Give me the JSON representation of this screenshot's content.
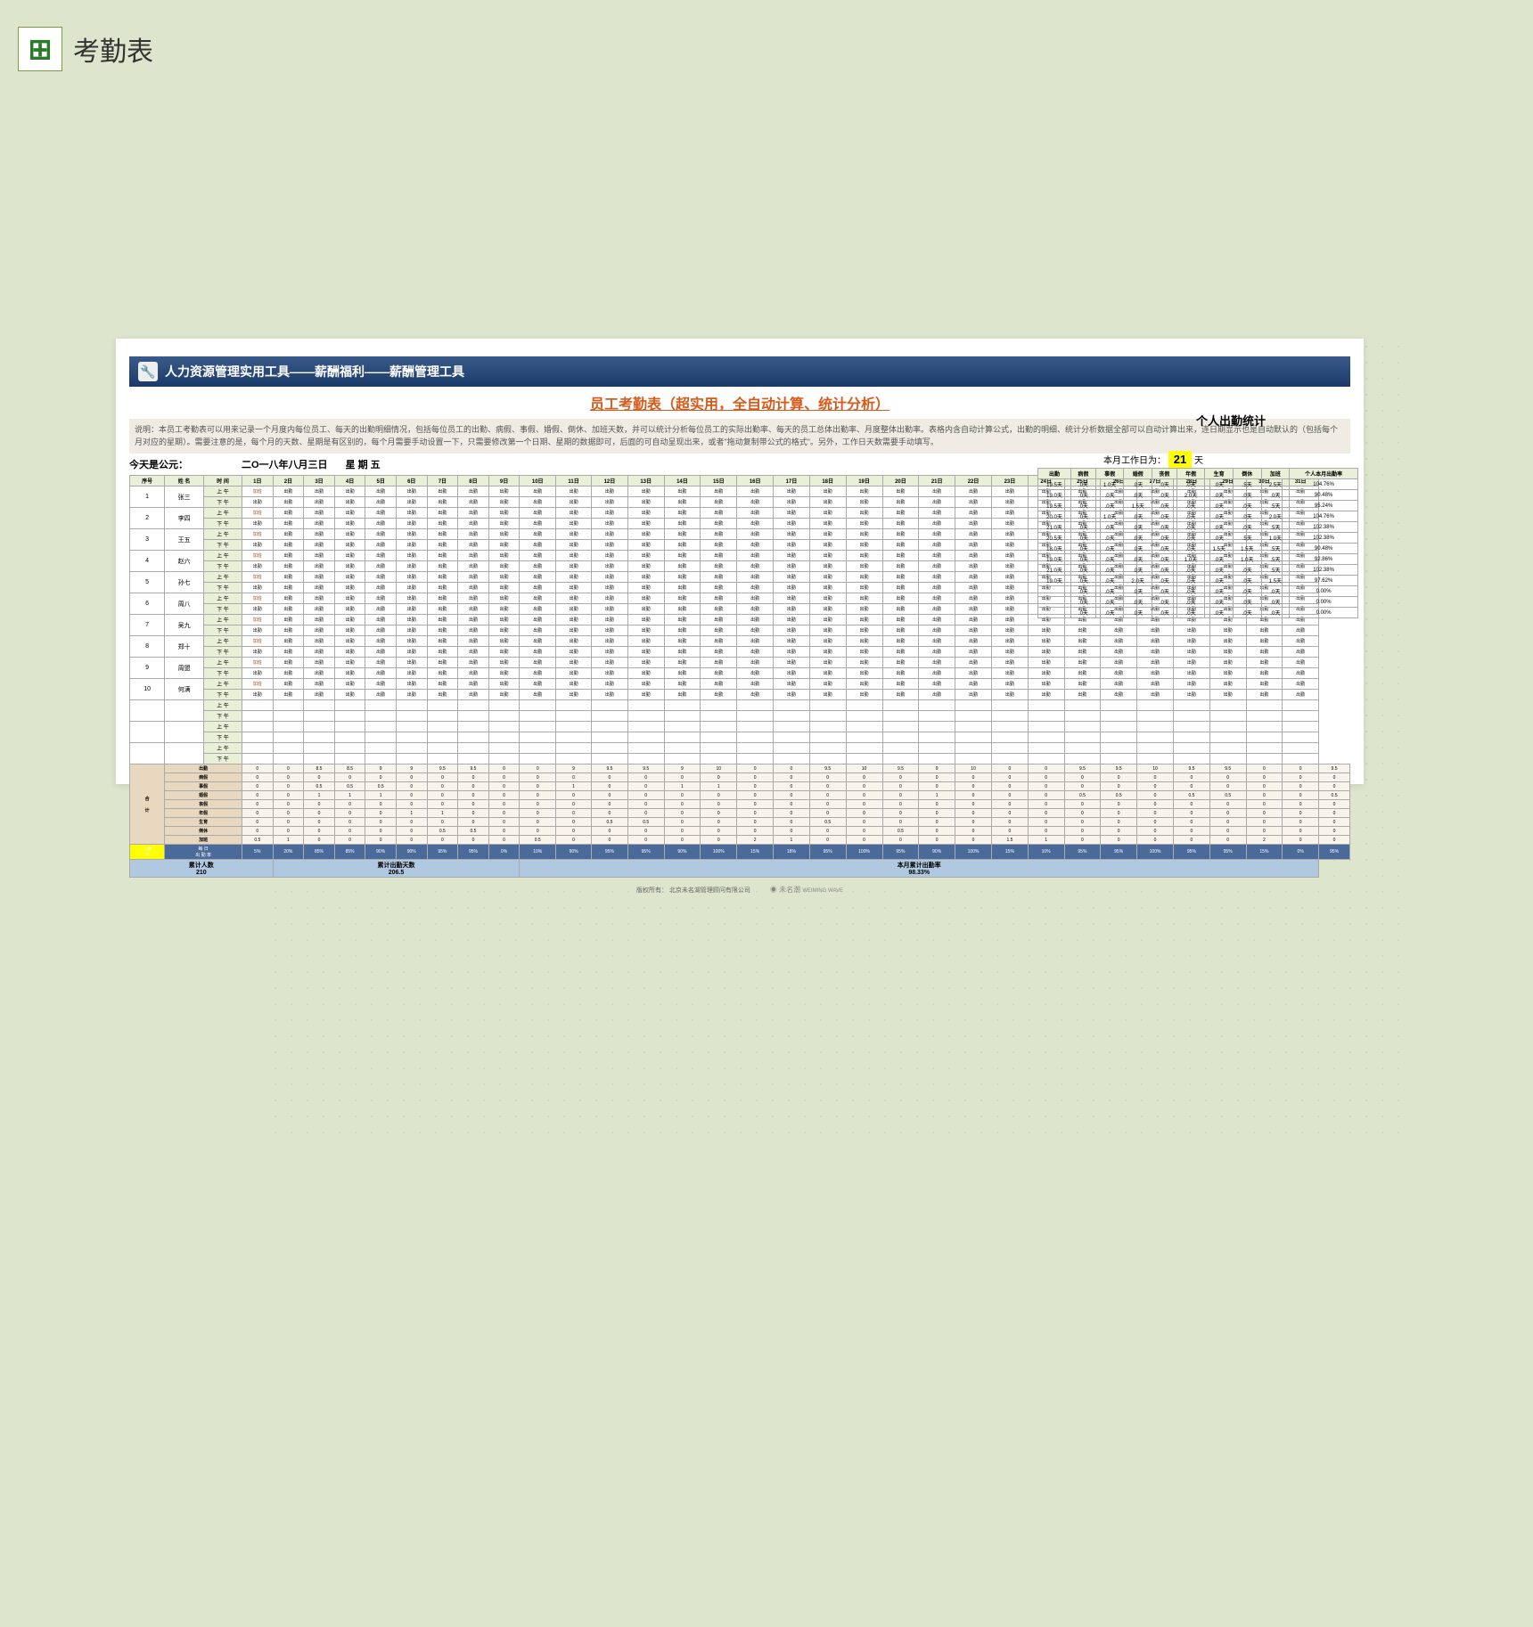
{
  "header": {
    "title": "考勤表"
  },
  "banner": "人力资源管理实用工具——薪酬福利——薪酬管理工具",
  "sub_title": "员工考勤表（超实用，全自动计算、统计分析）",
  "description": "说明：本员工考勤表可以用来记录一个月度内每位员工、每天的出勤明细情况，包括每位员工的出勤、病假、事假、婚假、倒休、加班天数，并可以统计分析每位员工的实际出勤率、每天的员工总体出勤率、月度整体出勤率。表格内含自动计算公式，出勤的明细、统计分析数据全部可以自动计算出来，连日期显示也是自动默认的（包括每个月对应的星期）。需要注意的是，每个月的天数、星期是有区别的，每个月需要手动设置一下，只需要修改第一个日期、星期的数据即可，后面的可自动呈现出来，或者\"拖动复制带公式的格式\"。另外，工作日天数需要手动填写。",
  "stats_title": "个人出勤统计",
  "today_label": "今天是公元：",
  "today_date": "二O一八年八月三日",
  "today_dow": "星 期  五",
  "workday_label": "本月工作日为：",
  "workday_value": "21",
  "workday_unit": "天",
  "main_headers": [
    "序号",
    "姓  名",
    "时 间"
  ],
  "days": [
    "1日",
    "2日",
    "3日",
    "4日",
    "5日",
    "6日",
    "7日",
    "8日",
    "9日",
    "10日",
    "11日",
    "12日",
    "13日",
    "14日",
    "15日",
    "16日",
    "17日",
    "18日",
    "19日",
    "20日",
    "21日",
    "22日",
    "23日",
    "24日",
    "25日",
    "26日",
    "27日",
    "28日",
    "29日",
    "30日",
    "31日"
  ],
  "employees": [
    {
      "no": "1",
      "name": "张三"
    },
    {
      "no": "2",
      "name": "李四"
    },
    {
      "no": "3",
      "name": "王五"
    },
    {
      "no": "4",
      "name": "赵六"
    },
    {
      "no": "5",
      "name": "孙七"
    },
    {
      "no": "6",
      "name": "周八"
    },
    {
      "no": "7",
      "name": "吴九"
    },
    {
      "no": "8",
      "name": "郑十"
    },
    {
      "no": "9",
      "name": "周盟"
    },
    {
      "no": "10",
      "name": "何满"
    }
  ],
  "time_labels": {
    "am": "上 午",
    "pm": "下 午"
  },
  "cell_values": {
    "attend": "出勤",
    "ot": "加班",
    "rest": "倒休",
    "sick": "病假",
    "marriage": "婚假",
    "personal": "事假",
    "year": "年假",
    "birth": "生育"
  },
  "stats_headers": [
    "出勤",
    "病假",
    "事假",
    "婚假",
    "丧假",
    "年假",
    "生育",
    "倒休",
    "加班",
    "个人本月出勤率"
  ],
  "stats_rows": [
    [
      "19.5天",
      ".0天",
      "1.0天",
      ".0天",
      ".0天",
      ".0天",
      ".0天",
      ".5天",
      "2.5天",
      "104.76%"
    ],
    [
      "19.0天",
      ".0天",
      ".0天",
      ".0天",
      ".0天",
      "2.0天",
      ".0天",
      ".0天",
      ".0天",
      "90.48%"
    ],
    [
      "19.5天",
      ".0天",
      ".0天",
      "1.5天",
      ".0天",
      ".0天",
      ".0天",
      ".0天",
      ".5天",
      "95.24%"
    ],
    [
      "20.0天",
      ".0天",
      "1.0天",
      ".0天",
      ".0天",
      ".0天",
      ".0天",
      ".0天",
      "2.0天",
      "104.76%"
    ],
    [
      "21.0天",
      ".0天",
      ".0天",
      ".0天",
      ".0天",
      ".0天",
      ".0天",
      ".0天",
      ".5天",
      "102.38%"
    ],
    [
      "20.5天",
      ".0天",
      ".0天",
      ".0天",
      ".0天",
      ".0天",
      ".0天",
      ".5天",
      "1.0天",
      "102.38%"
    ],
    [
      "18.0天",
      ".0天",
      ".0天",
      ".0天",
      ".0天",
      ".0天",
      "1.5天",
      "1.5天",
      ".5天",
      "90.48%"
    ],
    [
      "19.0天",
      ".0天",
      ".0天",
      ".0天",
      ".0天",
      "1.0天",
      ".0天",
      "1.0天",
      ".5天",
      "92.86%"
    ],
    [
      "21.0天",
      ".0天",
      ".0天",
      ".0天",
      ".0天",
      ".0天",
      ".0天",
      ".0天",
      ".5天",
      "102.38%"
    ],
    [
      "19.0天",
      ".0天",
      ".0天",
      "2.0天",
      ".0天",
      ".0天",
      ".0天",
      ".0天",
      "1.5天",
      "97.62%"
    ],
    [
      "",
      ".0天",
      ".0天",
      ".0天",
      ".0天",
      ".0天",
      ".0天",
      ".0天",
      ".0天",
      "0.00%"
    ],
    [
      "",
      ".0天",
      ".0天",
      ".0天",
      ".0天",
      ".0天",
      ".0天",
      ".0天",
      ".0天",
      "0.00%"
    ],
    [
      "",
      ".0天",
      ".0天",
      ".0天",
      ".0天",
      ".0天",
      ".0天",
      ".0天",
      ".0天",
      "0.00%"
    ]
  ],
  "sum_labels": [
    "出勤",
    "病假",
    "事假",
    "婚假",
    "丧假",
    "年假",
    "生育",
    "倒休",
    "加班"
  ],
  "sum_section_label": "合\n\n计",
  "sum_rows": {
    "出勤": [
      "0",
      "0",
      "8.5",
      "8.5",
      "9",
      "9",
      "9.5",
      "9.5",
      "0",
      "0",
      "9",
      "9.5",
      "9.5",
      "9",
      "10",
      "0",
      "0",
      "9.5",
      "10",
      "9.5",
      "9",
      "10",
      "0",
      "0",
      "9.5",
      "9.5",
      "10",
      "9.5",
      "9.5",
      "0",
      "0",
      "9.5"
    ],
    "病假": [
      "0",
      "0",
      "0",
      "0",
      "0",
      "0",
      "0",
      "0",
      "0",
      "0",
      "0",
      "0",
      "0",
      "0",
      "0",
      "0",
      "0",
      "0",
      "0",
      "0",
      "0",
      "0",
      "0",
      "0",
      "0",
      "0",
      "0",
      "0",
      "0",
      "0",
      "0",
      "0"
    ],
    "事假": [
      "0",
      "0",
      "0.5",
      "0.5",
      "0.5",
      "0",
      "0",
      "0",
      "0",
      "0",
      "1",
      "0",
      "0",
      "1",
      "1",
      "0",
      "0",
      "0",
      "0",
      "0",
      "0",
      "0",
      "0",
      "0",
      "0",
      "0",
      "0",
      "0",
      "0",
      "0",
      "0",
      "0"
    ],
    "婚假": [
      "0",
      "0",
      "1",
      "1",
      "1",
      "0",
      "0",
      "0",
      "0",
      "0",
      "0",
      "0",
      "0",
      "0",
      "0",
      "0",
      "0",
      "0",
      "0",
      "0",
      "1",
      "0",
      "0",
      "0",
      "0.5",
      "0.5",
      "0",
      "0.5",
      "0.5",
      "0",
      "0",
      "0.5"
    ],
    "丧假": [
      "0",
      "0",
      "0",
      "0",
      "0",
      "0",
      "0",
      "0",
      "0",
      "0",
      "0",
      "0",
      "0",
      "0",
      "0",
      "0",
      "0",
      "0",
      "0",
      "0",
      "0",
      "0",
      "0",
      "0",
      "0",
      "0",
      "0",
      "0",
      "0",
      "0",
      "0",
      "0"
    ],
    "年假": [
      "0",
      "0",
      "0",
      "0",
      "0",
      "1",
      "1",
      "0",
      "0",
      "0",
      "0",
      "0",
      "0",
      "0",
      "0",
      "0",
      "0",
      "0",
      "0",
      "0",
      "0",
      "0",
      "0",
      "0",
      "0",
      "0",
      "0",
      "0",
      "0",
      "0",
      "0",
      "0"
    ],
    "生育": [
      "0",
      "0",
      "0",
      "0",
      "0",
      "0",
      "0",
      "0",
      "0",
      "0",
      "0",
      "0.5",
      "0.5",
      "0",
      "0",
      "0",
      "0",
      "0.5",
      "0",
      "0",
      "0",
      "0",
      "0",
      "0",
      "0",
      "0",
      "0",
      "0",
      "0",
      "0",
      "0",
      "0"
    ],
    "倒休": [
      "0",
      "0",
      "0",
      "0",
      "0",
      "0",
      "0.5",
      "0.5",
      "0",
      "0",
      "0",
      "0",
      "0",
      "0",
      "0",
      "0",
      "0",
      "0",
      "0",
      "0.5",
      "0",
      "0",
      "0",
      "0",
      "0",
      "0",
      "0",
      "0",
      "0",
      "0",
      "0",
      "0"
    ],
    "加班": [
      "0.5",
      "1",
      "0",
      "0",
      "0",
      "0",
      "0",
      "0",
      "0",
      "0.5",
      "0",
      "0",
      "0",
      "0",
      "0",
      "2",
      "1",
      "0",
      "0",
      "0",
      "0",
      "0",
      "1.5",
      "1",
      "0",
      "0",
      "0",
      "0",
      "0",
      "2",
      "0",
      "0"
    ]
  },
  "people_label": "人数\n10",
  "rate_label": "每 日\n出 勤 率",
  "rate_values": [
    "5%",
    "20%",
    "85%",
    "85%",
    "90%",
    "90%",
    "95%",
    "95%",
    "0%",
    "10%",
    "90%",
    "95%",
    "95%",
    "90%",
    "100%",
    "15%",
    "18%",
    "95%",
    "100%",
    "95%",
    "90%",
    "100%",
    "15%",
    "10%",
    "95%",
    "95%",
    "100%",
    "95%",
    "95%",
    "15%",
    "0%",
    "95%"
  ],
  "final": {
    "a_label": "累计人数",
    "a_val": "210",
    "b_label": "累计出勤天数",
    "b_val": "206.5",
    "c_label": "本月累计出勤率",
    "c_val": "98.33%"
  },
  "footer": {
    "copyright": "版权所有：",
    "company": "北京未名湖管理顾问有限公司",
    "brand": "未名潮",
    "brand_en": "WEIMING WAVE"
  }
}
